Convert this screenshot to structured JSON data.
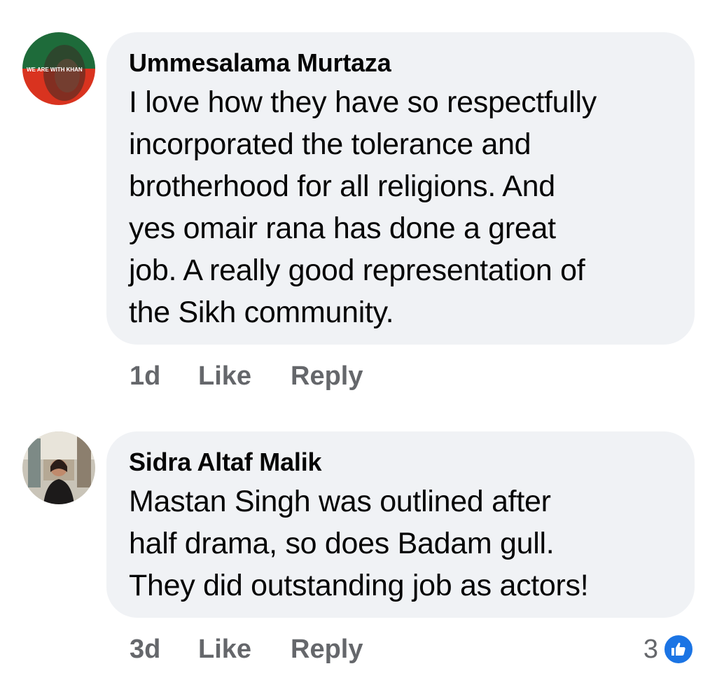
{
  "comments": [
    {
      "author": "Ummesalama Murtaza",
      "avatar_text": "WE ARE WITH KHAN",
      "text_lines": [
        "I love how they have so respectfully",
        "incorporated the tolerance and",
        "brotherhood for all religions. And",
        "yes omair rana has done a great",
        "job. A really good representation of",
        "the Sikh community."
      ],
      "time": "1d",
      "like_label": "Like",
      "reply_label": "Reply"
    },
    {
      "author": "Sidra Altaf Malik",
      "text_lines": [
        "Mastan Singh was outlined after",
        "half drama, so does Badam gull.",
        "They did outstanding job as actors!"
      ],
      "time": "3d",
      "like_label": "Like",
      "reply_label": "Reply",
      "reaction_count": "3",
      "reaction_icon": "thumbs-up-icon"
    }
  ],
  "colors": {
    "bubble": "#f0f2f5",
    "muted_text": "#65676b",
    "like_blue": "#1b74e4"
  }
}
